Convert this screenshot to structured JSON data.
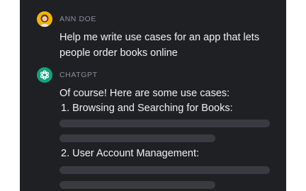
{
  "conversation": {
    "user": {
      "name": "ANN DOE",
      "message": "Help me write use cases for an app that lets people order books online"
    },
    "assistant": {
      "name": "CHATGPT",
      "intro": "Of course! Here are some use cases:",
      "use_cases": [
        {
          "title": "1. Browsing and Searching for Books:"
        },
        {
          "title": "2. User Account Management:"
        }
      ]
    }
  },
  "colors": {
    "panel_bg": "#1f2023",
    "placeholder_bar": "#3a3b40",
    "assistant_accent": "#10a37f",
    "user_avatar_bg": "#f4b400"
  },
  "icons": {
    "assistant_avatar": "openai-logo-icon",
    "user_avatar": "user-avatar"
  }
}
